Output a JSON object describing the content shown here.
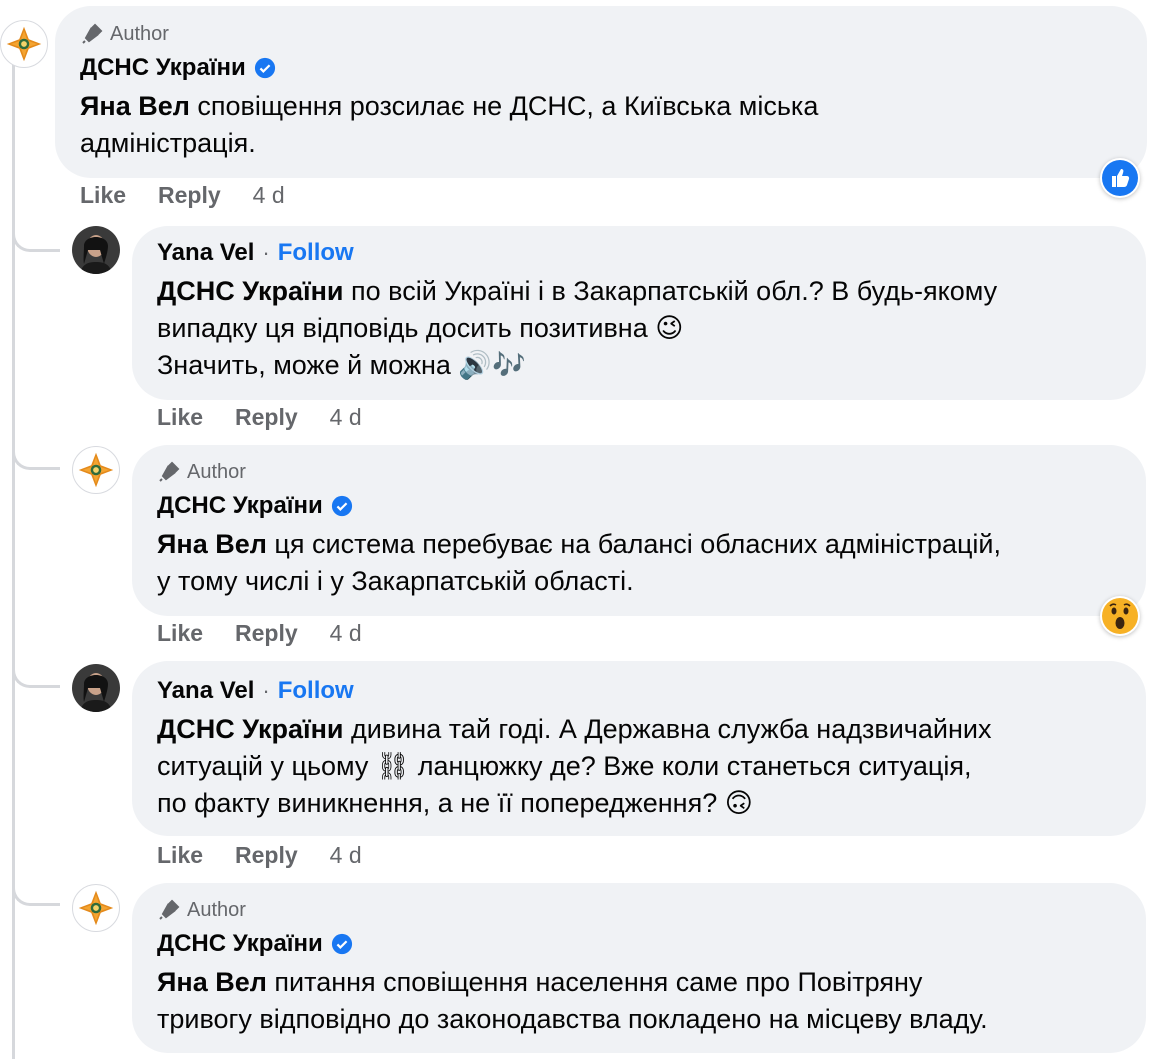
{
  "thread": {
    "comments": [
      {
        "badge": "Author",
        "name": "ДСНС України",
        "mention": "Яна Вел",
        "lines": [
          "сповіщення розсилає не ДСНС, а Київська міська",
          "адміністрація."
        ],
        "like": "Like",
        "reply": "Reply",
        "time": "4 d",
        "reaction": "like-reaction-icon"
      },
      {
        "name": "Yana Vel",
        "follow": "Follow",
        "mention": "ДСНС України",
        "lines": [
          "по всій Україні і в Закарпатській обл.? В будь-якому",
          "випадку ця відповідь досить позитивна 😉",
          "Значить, може й можна 🔊🎶"
        ],
        "like": "Like",
        "reply": "Reply",
        "time": "4 d"
      },
      {
        "badge": "Author",
        "name": "ДСНС України",
        "mention": "Яна Вел",
        "lines": [
          "ця система перебуває на балансі обласних адміністрацій,",
          "у тому числі і у Закарпатській області."
        ],
        "like": "Like",
        "reply": "Reply",
        "time": "4 d",
        "reaction": "wow-reaction-icon"
      },
      {
        "name": "Yana Vel",
        "follow": "Follow",
        "mention": "ДСНС України",
        "lines": [
          "дивина тай годі. А Державна служба надзвичайних",
          "ситуацій у цьому ⛓ ланцюжку де? Вже коли станеться ситуація,",
          "по факту виникнення, а не її попередження? 🙃"
        ],
        "like": "Like",
        "reply": "Reply",
        "time": "4 d"
      },
      {
        "badge": "Author",
        "name": "ДСНС України",
        "mention": "Яна Вел",
        "lines": [
          "питання сповіщення населення саме про Повітряну",
          "тривогу відповідно до законодавства покладено на місцеву владу."
        ]
      }
    ]
  }
}
